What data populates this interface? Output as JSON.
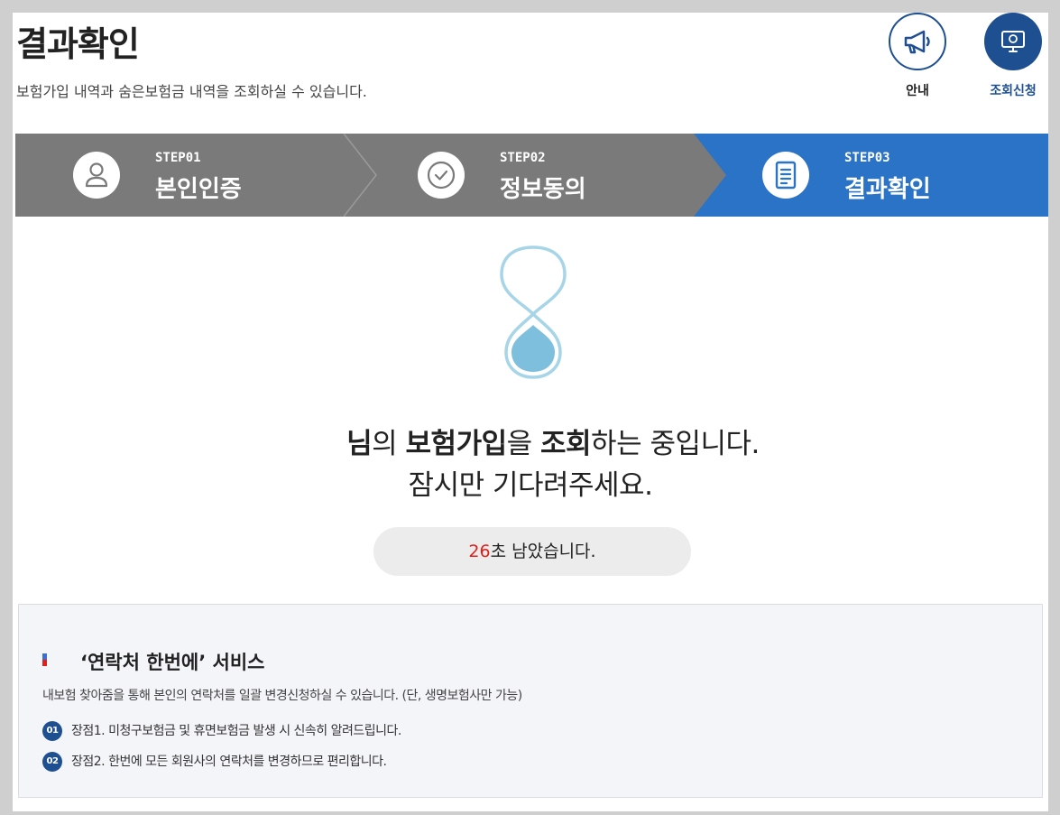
{
  "header": {
    "title": "결과확인",
    "subtitle": "보험가입 내역과 숨은보험금 내역을 조회하실 수 있습니다.",
    "buttons": {
      "info_label": "안내",
      "apply_label": "조회신청"
    }
  },
  "steps": [
    {
      "number": "STEP01",
      "label": "본인인증",
      "icon": "user-icon",
      "active": false
    },
    {
      "number": "STEP02",
      "label": "정보동의",
      "icon": "check-circle-icon",
      "active": false
    },
    {
      "number": "STEP03",
      "label": "결과확인",
      "icon": "document-icon",
      "active": true
    }
  ],
  "status": {
    "line1": {
      "a": "님",
      "b": "의 ",
      "c": "보험가입",
      "d": "을 ",
      "e": "조회",
      "f": "하는 중입니다."
    },
    "line2": "잠시만 기다려주세요.",
    "timer_seconds": "26",
    "timer_suffix": "초 남았습니다."
  },
  "service": {
    "title": "‘연락처 한번에’ 서비스",
    "description": "내보험 찾아줌을 통해 본인의 연락처를 일괄 변경신청하실 수 있습니다. (단, 생명보험사만 가능)",
    "items": [
      {
        "num": "01",
        "text": "장점1. 미청구보험금 및 휴면보험금 발생 시 신속히 알려드립니다."
      },
      {
        "num": "02",
        "text": "장점2. 한번에 모든 회원사의 연락처를 변경하므로 편리합니다."
      }
    ]
  },
  "colors": {
    "brand_blue": "#1e4f91",
    "step_active": "#2a73c6",
    "step_inactive": "#7a7a7a",
    "timer_red": "#e0201c"
  }
}
